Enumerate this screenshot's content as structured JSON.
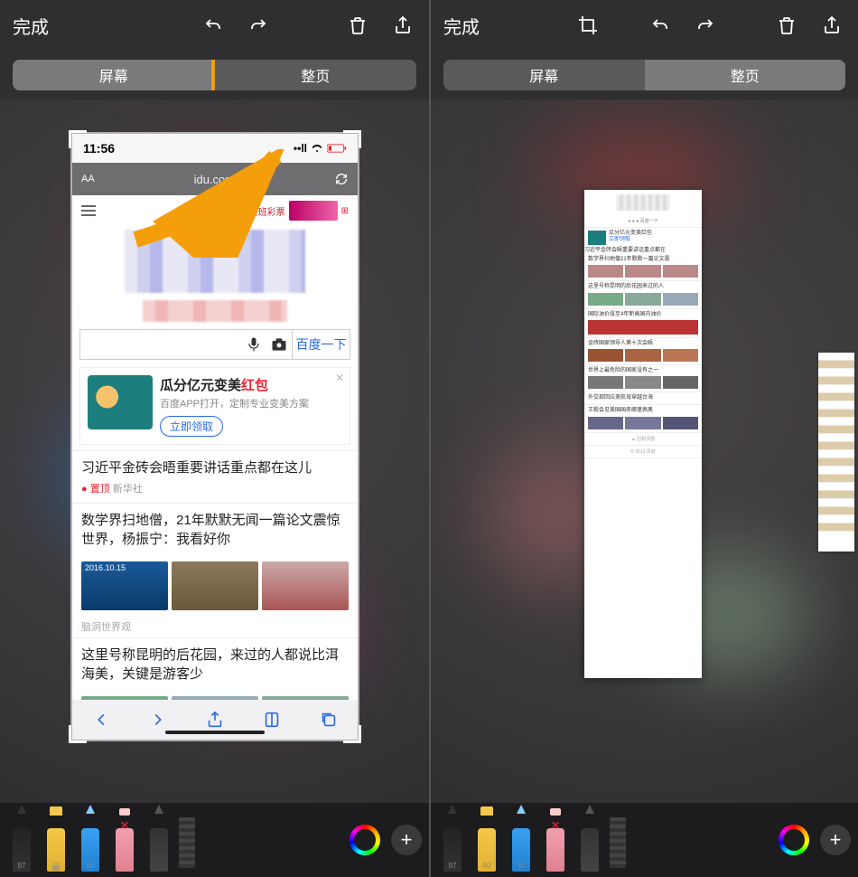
{
  "toolbar": {
    "done": "完成",
    "tabs": {
      "screen": "屏幕",
      "fullpage": "整页"
    }
  },
  "left": {
    "status_time": "11:56",
    "url_prefix": "AA",
    "url": "idu.com",
    "search_button": "百度一下",
    "promo": {
      "title_a": "瓜分亿元变美",
      "title_b": "红包",
      "sub": "百度APP打开，定制专业变美方案",
      "cta": "立即领取"
    },
    "news1": {
      "title": "习近平金砖会晤重要讲话重点都在这儿",
      "tag": "置顶",
      "src": "新华社"
    },
    "news2": {
      "title": "数学界扫地僧，21年默默无闻一篇论文震惊世界，杨振宁：我看好你",
      "date": "2016.10.15"
    },
    "category": "脑洞世界观",
    "news3": {
      "title": "这里号称昆明的后花园，来过的人都说比洱海美，关键是游客少"
    }
  },
  "tools": {
    "pen_num": "97",
    "marker_num": "80",
    "pencil_num": "50"
  }
}
